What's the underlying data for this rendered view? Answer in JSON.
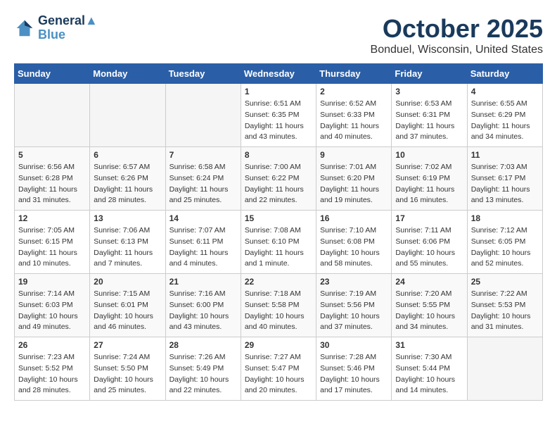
{
  "header": {
    "logo_line1": "General",
    "logo_line2": "Blue",
    "month_title": "October 2025",
    "location": "Bonduel, Wisconsin, United States"
  },
  "days_of_week": [
    "Sunday",
    "Monday",
    "Tuesday",
    "Wednesday",
    "Thursday",
    "Friday",
    "Saturday"
  ],
  "weeks": [
    [
      {
        "day": "",
        "empty": true
      },
      {
        "day": "",
        "empty": true
      },
      {
        "day": "",
        "empty": true
      },
      {
        "day": "1",
        "sunrise": "6:51 AM",
        "sunset": "6:35 PM",
        "daylight": "11 hours and 43 minutes."
      },
      {
        "day": "2",
        "sunrise": "6:52 AM",
        "sunset": "6:33 PM",
        "daylight": "11 hours and 40 minutes."
      },
      {
        "day": "3",
        "sunrise": "6:53 AM",
        "sunset": "6:31 PM",
        "daylight": "11 hours and 37 minutes."
      },
      {
        "day": "4",
        "sunrise": "6:55 AM",
        "sunset": "6:29 PM",
        "daylight": "11 hours and 34 minutes."
      }
    ],
    [
      {
        "day": "5",
        "sunrise": "6:56 AM",
        "sunset": "6:28 PM",
        "daylight": "11 hours and 31 minutes."
      },
      {
        "day": "6",
        "sunrise": "6:57 AM",
        "sunset": "6:26 PM",
        "daylight": "11 hours and 28 minutes."
      },
      {
        "day": "7",
        "sunrise": "6:58 AM",
        "sunset": "6:24 PM",
        "daylight": "11 hours and 25 minutes."
      },
      {
        "day": "8",
        "sunrise": "7:00 AM",
        "sunset": "6:22 PM",
        "daylight": "11 hours and 22 minutes."
      },
      {
        "day": "9",
        "sunrise": "7:01 AM",
        "sunset": "6:20 PM",
        "daylight": "11 hours and 19 minutes."
      },
      {
        "day": "10",
        "sunrise": "7:02 AM",
        "sunset": "6:19 PM",
        "daylight": "11 hours and 16 minutes."
      },
      {
        "day": "11",
        "sunrise": "7:03 AM",
        "sunset": "6:17 PM",
        "daylight": "11 hours and 13 minutes."
      }
    ],
    [
      {
        "day": "12",
        "sunrise": "7:05 AM",
        "sunset": "6:15 PM",
        "daylight": "11 hours and 10 minutes."
      },
      {
        "day": "13",
        "sunrise": "7:06 AM",
        "sunset": "6:13 PM",
        "daylight": "11 hours and 7 minutes."
      },
      {
        "day": "14",
        "sunrise": "7:07 AM",
        "sunset": "6:11 PM",
        "daylight": "11 hours and 4 minutes."
      },
      {
        "day": "15",
        "sunrise": "7:08 AM",
        "sunset": "6:10 PM",
        "daylight": "11 hours and 1 minute."
      },
      {
        "day": "16",
        "sunrise": "7:10 AM",
        "sunset": "6:08 PM",
        "daylight": "10 hours and 58 minutes."
      },
      {
        "day": "17",
        "sunrise": "7:11 AM",
        "sunset": "6:06 PM",
        "daylight": "10 hours and 55 minutes."
      },
      {
        "day": "18",
        "sunrise": "7:12 AM",
        "sunset": "6:05 PM",
        "daylight": "10 hours and 52 minutes."
      }
    ],
    [
      {
        "day": "19",
        "sunrise": "7:14 AM",
        "sunset": "6:03 PM",
        "daylight": "10 hours and 49 minutes."
      },
      {
        "day": "20",
        "sunrise": "7:15 AM",
        "sunset": "6:01 PM",
        "daylight": "10 hours and 46 minutes."
      },
      {
        "day": "21",
        "sunrise": "7:16 AM",
        "sunset": "6:00 PM",
        "daylight": "10 hours and 43 minutes."
      },
      {
        "day": "22",
        "sunrise": "7:18 AM",
        "sunset": "5:58 PM",
        "daylight": "10 hours and 40 minutes."
      },
      {
        "day": "23",
        "sunrise": "7:19 AM",
        "sunset": "5:56 PM",
        "daylight": "10 hours and 37 minutes."
      },
      {
        "day": "24",
        "sunrise": "7:20 AM",
        "sunset": "5:55 PM",
        "daylight": "10 hours and 34 minutes."
      },
      {
        "day": "25",
        "sunrise": "7:22 AM",
        "sunset": "5:53 PM",
        "daylight": "10 hours and 31 minutes."
      }
    ],
    [
      {
        "day": "26",
        "sunrise": "7:23 AM",
        "sunset": "5:52 PM",
        "daylight": "10 hours and 28 minutes."
      },
      {
        "day": "27",
        "sunrise": "7:24 AM",
        "sunset": "5:50 PM",
        "daylight": "10 hours and 25 minutes."
      },
      {
        "day": "28",
        "sunrise": "7:26 AM",
        "sunset": "5:49 PM",
        "daylight": "10 hours and 22 minutes."
      },
      {
        "day": "29",
        "sunrise": "7:27 AM",
        "sunset": "5:47 PM",
        "daylight": "10 hours and 20 minutes."
      },
      {
        "day": "30",
        "sunrise": "7:28 AM",
        "sunset": "5:46 PM",
        "daylight": "10 hours and 17 minutes."
      },
      {
        "day": "31",
        "sunrise": "7:30 AM",
        "sunset": "5:44 PM",
        "daylight": "10 hours and 14 minutes."
      },
      {
        "day": "",
        "empty": true
      }
    ]
  ]
}
